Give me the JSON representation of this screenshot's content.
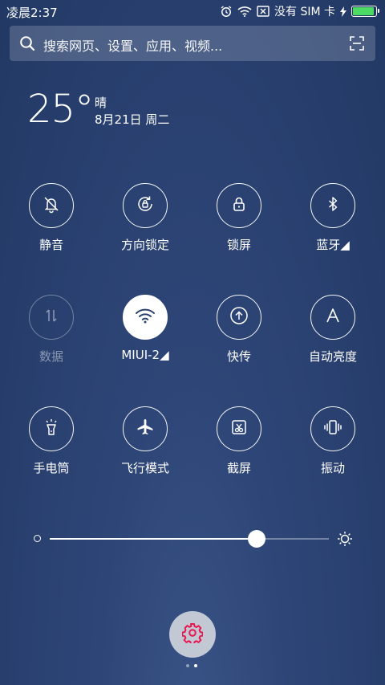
{
  "status_bar": {
    "time": "凌晨2:37",
    "carrier": "没有 SIM 卡",
    "battery_level": 1.0,
    "battery_color": "#4cd964"
  },
  "search": {
    "placeholder": "搜索网页、设置、应用、视频...",
    "icon": "search-icon",
    "scan_icon": "scan-icon"
  },
  "weather": {
    "temperature": "25°",
    "condition": "晴",
    "date": "8月21日 周二"
  },
  "toggles": [
    {
      "label": "静音",
      "icon": "silent-bell-icon",
      "state": "off"
    },
    {
      "label": "方向锁定",
      "icon": "rotation-lock-icon",
      "state": "off"
    },
    {
      "label": "锁屏",
      "icon": "lock-icon",
      "state": "off"
    },
    {
      "label": "蓝牙◢",
      "icon": "bluetooth-icon",
      "state": "off"
    },
    {
      "label": "数据",
      "icon": "data-arrows-icon",
      "state": "disabled"
    },
    {
      "label": "MIUI-2◢",
      "icon": "wifi-icon",
      "state": "on"
    },
    {
      "label": "快传",
      "icon": "upload-icon",
      "state": "off"
    },
    {
      "label": "自动亮度",
      "icon": "auto-brightness-icon",
      "state": "off"
    },
    {
      "label": "手电筒",
      "icon": "flashlight-icon",
      "state": "off"
    },
    {
      "label": "飞行模式",
      "icon": "airplane-icon",
      "state": "off"
    },
    {
      "label": "截屏",
      "icon": "screenshot-icon",
      "state": "off"
    },
    {
      "label": "振动",
      "icon": "vibrate-icon",
      "state": "off"
    }
  ],
  "brightness": {
    "level": 0.74
  },
  "settings": {
    "icon": "gear-icon",
    "color": "#e8174f"
  },
  "pager": {
    "pages": 2,
    "current": 2
  }
}
